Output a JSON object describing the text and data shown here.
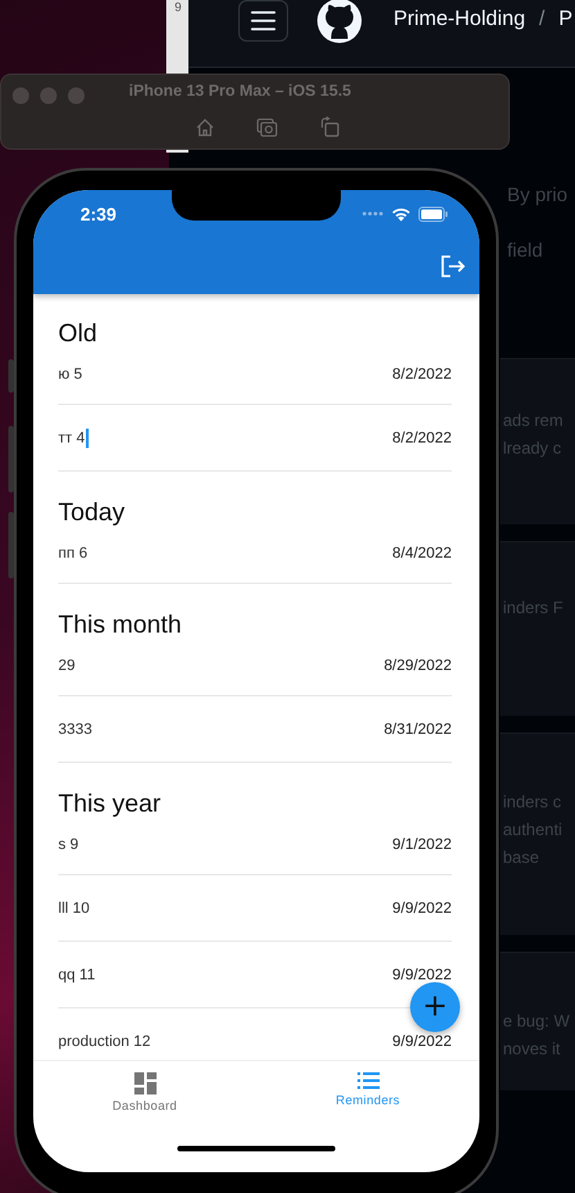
{
  "back_window": {
    "text": "9"
  },
  "browser": {
    "owner": "Prime-Holding",
    "separator": "/",
    "repo": "P",
    "toolbar": [
      {
        "text": "By prio"
      },
      {
        "text": "field"
      }
    ],
    "cards": [
      {
        "lines": [
          "ads rem",
          "lready c"
        ]
      },
      {
        "lines": [
          "inders F"
        ]
      },
      {
        "lines": [
          "inders c",
          "authenti",
          "base"
        ]
      },
      {
        "lines": [
          "e bug: W",
          "noves it"
        ]
      }
    ]
  },
  "simulator": {
    "title": "iPhone 13 Pro Max – iOS 15.5"
  },
  "phone": {
    "time": "2:39",
    "sections": [
      {
        "title": "Old",
        "reminders": [
          {
            "title": "ю 5",
            "date": "8/2/2022",
            "cursor": false
          },
          {
            "title": "тт 4",
            "date": "8/2/2022",
            "cursor": true
          }
        ]
      },
      {
        "title": "Today",
        "reminders": [
          {
            "title": "пп 6",
            "date": "8/4/2022",
            "cursor": false
          }
        ]
      },
      {
        "title": "This month",
        "reminders": [
          {
            "title": "29",
            "date": "8/29/2022",
            "cursor": false
          },
          {
            "title": "3333",
            "date": "8/31/2022",
            "cursor": false
          }
        ]
      },
      {
        "title": "This year",
        "reminders": [
          {
            "title": "s 9",
            "date": "9/1/2022",
            "cursor": false
          },
          {
            "title": "lll 10",
            "date": "9/9/2022",
            "cursor": false
          },
          {
            "title": "qq 11",
            "date": "9/9/2022",
            "cursor": false
          },
          {
            "title": "production 12",
            "date": "9/9/2022",
            "cursor": false
          }
        ]
      }
    ],
    "fab": {
      "label": "+"
    },
    "bottom_nav": [
      {
        "label": "Dashboard",
        "kind": "dashboard",
        "selected": false
      },
      {
        "label": "Reminders",
        "kind": "list",
        "selected": true
      }
    ]
  }
}
